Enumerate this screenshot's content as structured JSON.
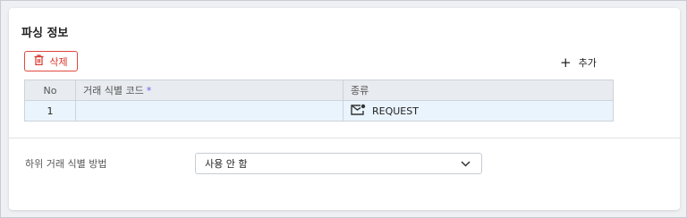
{
  "section": {
    "title": "파싱 정보"
  },
  "toolbar": {
    "delete_label": "삭제",
    "add_label": "추가"
  },
  "table": {
    "columns": [
      "No",
      "거래 식별 코드",
      "종류"
    ],
    "required_marker": "*",
    "rows": [
      {
        "no": "1",
        "identifier_code": "",
        "type": "REQUEST",
        "type_icon": "mail-icon"
      }
    ]
  },
  "sub_transaction": {
    "label": "하위 거래 식별 방법",
    "selected": "사용 안 함"
  },
  "colors": {
    "danger": "#d8362b",
    "selected_row": "#eaf4fd",
    "header_bg": "#e8ebef",
    "required_accent": "#6b5ce7"
  }
}
